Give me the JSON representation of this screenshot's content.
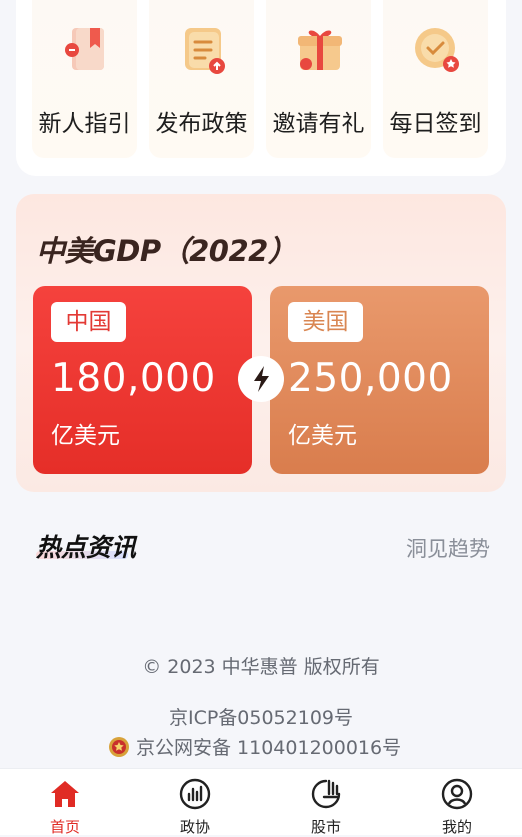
{
  "quick_actions": [
    {
      "label": "新人指引",
      "icon": "guide-book-icon"
    },
    {
      "label": "发布政策",
      "icon": "publish-document-icon"
    },
    {
      "label": "邀请有礼",
      "icon": "gift-box-icon"
    },
    {
      "label": "每日签到",
      "icon": "checkin-badge-icon"
    }
  ],
  "gdp": {
    "title": "中美GDP（2022）",
    "china": {
      "name": "中国",
      "value": "180,000",
      "unit": "亿美元"
    },
    "usa": {
      "name": "美国",
      "value": "250,000",
      "unit": "亿美元"
    },
    "vs_icon": "lightning-icon"
  },
  "hot_news": {
    "title": "热点资讯",
    "more": "洞见趋势"
  },
  "footer": {
    "copyright": "© 2023 中华惠普 版权所有",
    "icp": "京ICP备05052109号",
    "police": "京公网安备 110401200016号"
  },
  "tabbar": [
    {
      "label": "首页",
      "icon": "home-icon",
      "active": true
    },
    {
      "label": "政协",
      "icon": "chart-circle-icon",
      "active": false
    },
    {
      "label": "股市",
      "icon": "stock-icon",
      "active": false
    },
    {
      "label": "我的",
      "icon": "user-icon",
      "active": false
    }
  ],
  "colors": {
    "accent": "#e02b24",
    "china_card": "#ee3a34",
    "usa_card": "#e08c5c",
    "gdp_bg": "#fde9e3"
  }
}
